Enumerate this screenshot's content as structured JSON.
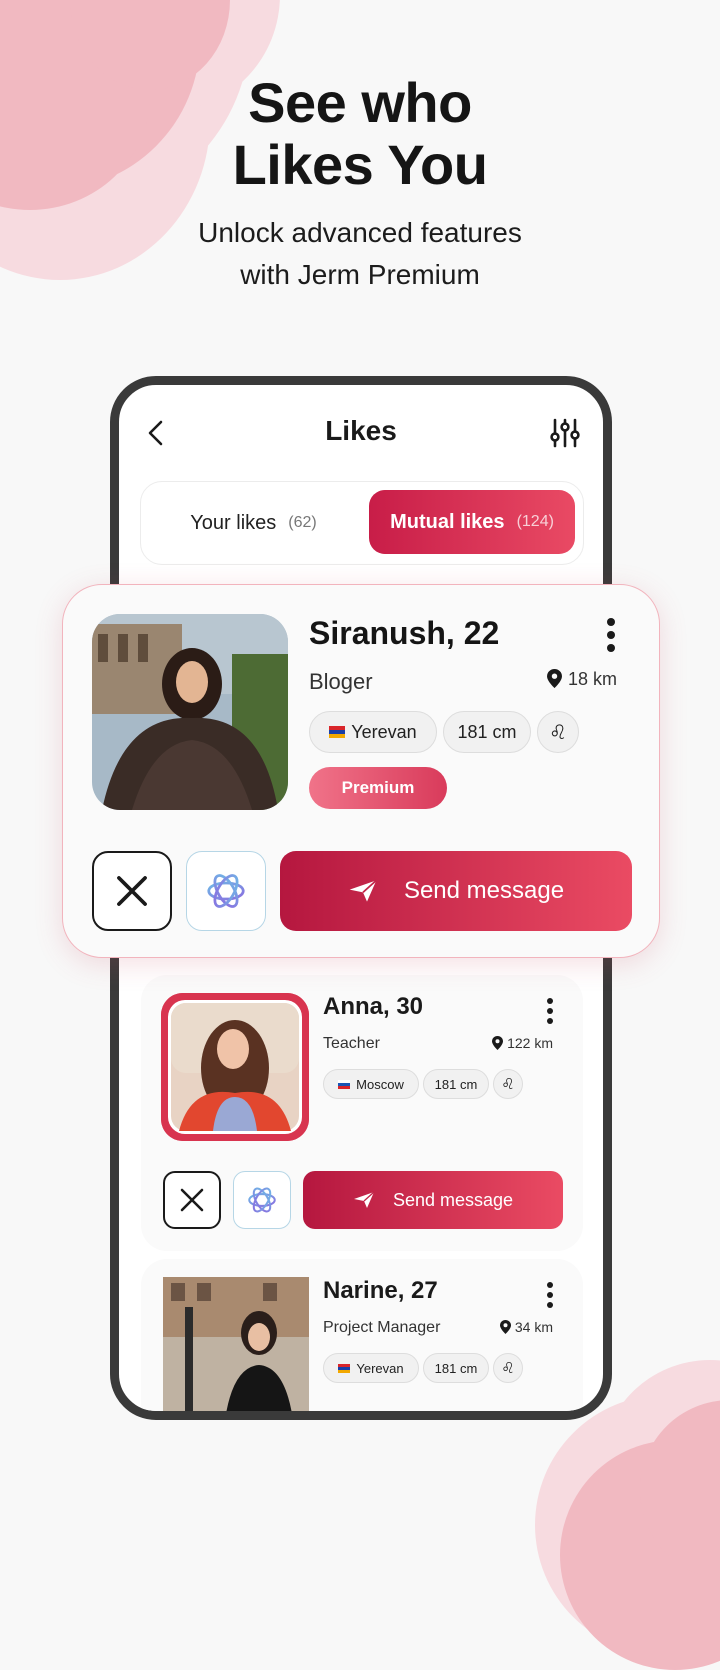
{
  "hero": {
    "title_line1": "See who",
    "title_line2": "Likes You",
    "subtitle_line1": "Unlock advanced features",
    "subtitle_line2": "with Jerm Premium"
  },
  "header": {
    "title": "Likes",
    "back_icon": "chevron-left-icon",
    "filter_icon": "sliders-icon"
  },
  "tabs": {
    "your_likes_label": "Your likes",
    "your_likes_count": "(62)",
    "mutual_likes_label": "Mutual likes",
    "mutual_likes_count": "(124)"
  },
  "colors": {
    "accent": "#c81d48",
    "accent_light": "#ea4b63",
    "premium": "#f07389",
    "frame": "#3a3a3a"
  },
  "profiles": [
    {
      "name": "Siranush, 22",
      "job": "Bloger",
      "distance": "18 km",
      "city": "Yerevan",
      "height": "181 cm",
      "zodiac": "♌",
      "badge": "Premium",
      "send_label": "Send message"
    },
    {
      "name": "Anna, 30",
      "job": "Teacher",
      "distance": "122 km",
      "city": "Moscow",
      "height": "181 cm",
      "zodiac": "♌",
      "send_label": "Send message"
    },
    {
      "name": "Narine, 27",
      "job": "Project Manager",
      "distance": "34 km",
      "city": "Yerevan",
      "height": "181 cm",
      "zodiac": "♌"
    }
  ]
}
